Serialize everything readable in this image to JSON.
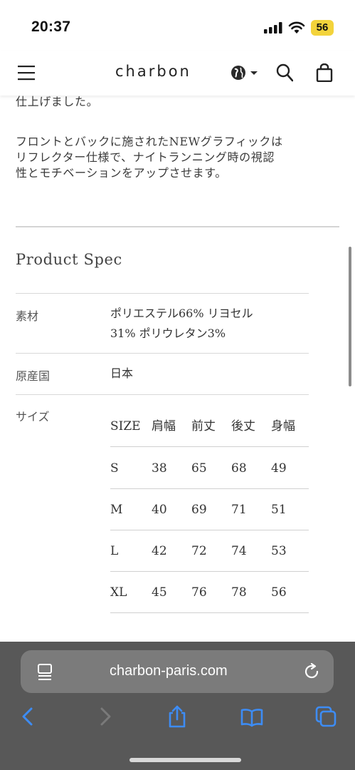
{
  "status_bar": {
    "time": "20:37",
    "battery": "56",
    "battery_color": "#f3d33b"
  },
  "header": {
    "brand": "charbon",
    "icons": [
      "menu-icon",
      "globe-icon",
      "chevron-down-icon",
      "search-icon",
      "bag-icon"
    ]
  },
  "description": {
    "partial_line": "仕上げました。",
    "lines": [
      "フロントとバックに施されたNEWグラフィックは",
      "リフレクター仕様で、ナイトランニング時の視認",
      "性とモチベーションをアップさせます。"
    ]
  },
  "spec": {
    "title": "Product Spec",
    "material_label": "素材",
    "material_value_line1": "ポリエステル66% リヨセル",
    "material_value_line2": "31% ポリウレタン3%",
    "origin_label": "原産国",
    "origin_value": "日本",
    "size_label": "サイズ"
  },
  "size_table": {
    "headers": [
      "SIZE",
      "肩幅",
      "前丈",
      "後丈",
      "身幅"
    ],
    "rows": [
      [
        "S",
        "38",
        "65",
        "68",
        "49"
      ],
      [
        "M",
        "40",
        "69",
        "71",
        "51"
      ],
      [
        "L",
        "42",
        "72",
        "74",
        "53"
      ],
      [
        "XL",
        "45",
        "76",
        "78",
        "56"
      ]
    ]
  },
  "browser": {
    "url": "charbon-paris.com",
    "accent": "#3d8cf5",
    "toolbar_icons": [
      "back-icon",
      "forward-icon",
      "share-icon",
      "bookmarks-icon",
      "tabs-overview-icon"
    ]
  }
}
